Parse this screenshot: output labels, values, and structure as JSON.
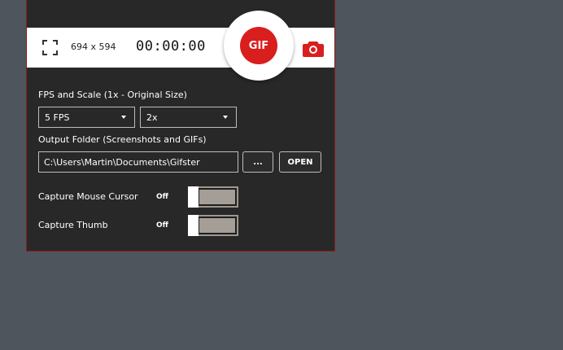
{
  "toolbar": {
    "dimensions": "694 x 594",
    "timer": "00:00:00",
    "gif_label": "GIF"
  },
  "fps_scale": {
    "label": "FPS and Scale (1x - Original Size)",
    "fps_value": "5 FPS",
    "scale_value": "2x"
  },
  "output": {
    "label": "Output Folder (Screenshots and GIFs)",
    "path": "C:\\Users\\Martin\\Documents\\Gifster",
    "browse_label": "...",
    "open_label": "OPEN"
  },
  "options": [
    {
      "label": "Capture Mouse Cursor",
      "state": "Off"
    },
    {
      "label": "Capture Thumb",
      "state": "Off"
    }
  ],
  "colors": {
    "accent": "#d91e1e",
    "panel": "#282828",
    "desktop": "#4e555c"
  }
}
